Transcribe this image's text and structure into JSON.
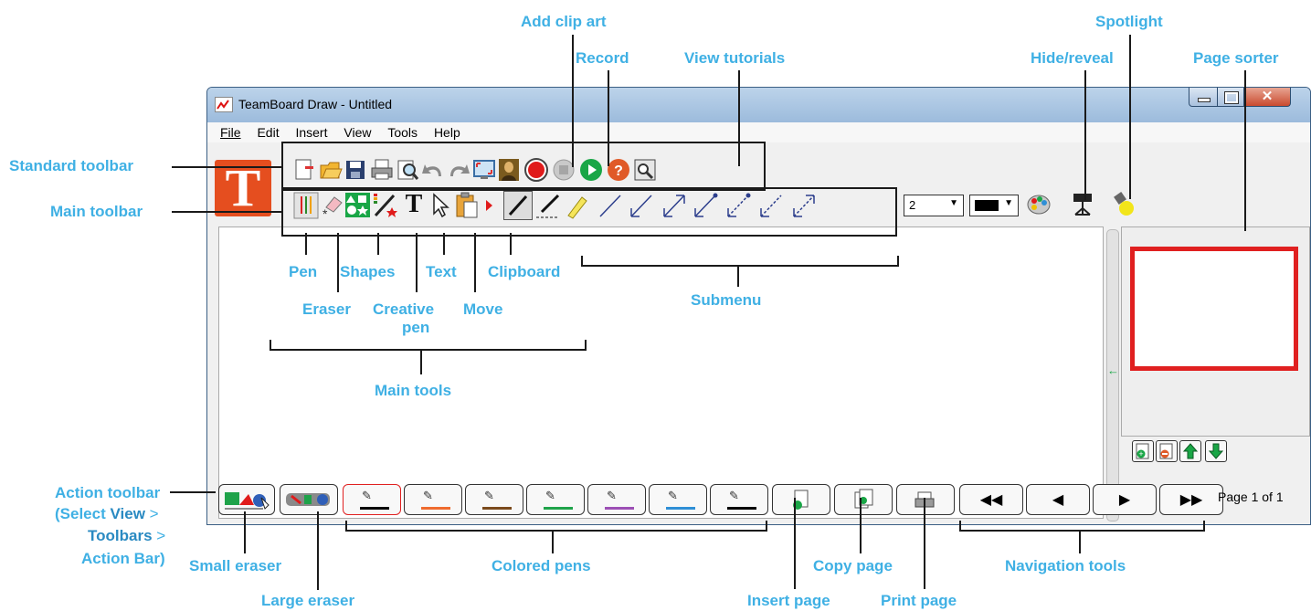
{
  "window": {
    "title": "TeamBoard Draw - Untitled",
    "menu": [
      "File",
      "Edit",
      "Insert",
      "View",
      "Tools",
      "Help"
    ],
    "line_width": "2",
    "page_info": "Page 1 of 1"
  },
  "callouts": {
    "add_clip_art": "Add clip art",
    "record": "Record",
    "view_tutorials": "View tutorials",
    "hide_reveal": "Hide/reveal",
    "spotlight": "Spotlight",
    "page_sorter": "Page sorter",
    "standard_toolbar": "Standard toolbar",
    "main_toolbar": "Main toolbar",
    "pen": "Pen",
    "shapes": "Shapes",
    "text": "Text",
    "clipboard": "Clipboard",
    "eraser": "Eraser",
    "creative_pen_1": "Creative",
    "creative_pen_2": "pen",
    "move": "Move",
    "submenu": "Submenu",
    "main_tools": "Main tools",
    "action_toolbar_1": "Action toolbar",
    "action_toolbar_2a": "(Select ",
    "action_toolbar_2b": "View",
    "action_toolbar_2c": " >",
    "action_toolbar_3a": "Toolbars",
    "action_toolbar_3b": " >",
    "action_toolbar_4": "Action Bar)",
    "small_eraser": "Small eraser",
    "large_eraser": "Large eraser",
    "colored_pens": "Colored pens",
    "insert_page": "Insert page",
    "copy_page": "Copy page",
    "print_page": "Print page",
    "navigation_tools": "Navigation tools"
  },
  "icons": {
    "logo_letter": "T",
    "text_tool": "T"
  },
  "colors": {
    "callout": "#3fb0e4",
    "pen_colors": [
      "#000000",
      "#ef6b2e",
      "#7a4a1c",
      "#1fa34a",
      "#9c4fb5",
      "#2f8fd6",
      "#000000"
    ],
    "logo": "#e54e1f",
    "page_frame": "#e02020"
  }
}
